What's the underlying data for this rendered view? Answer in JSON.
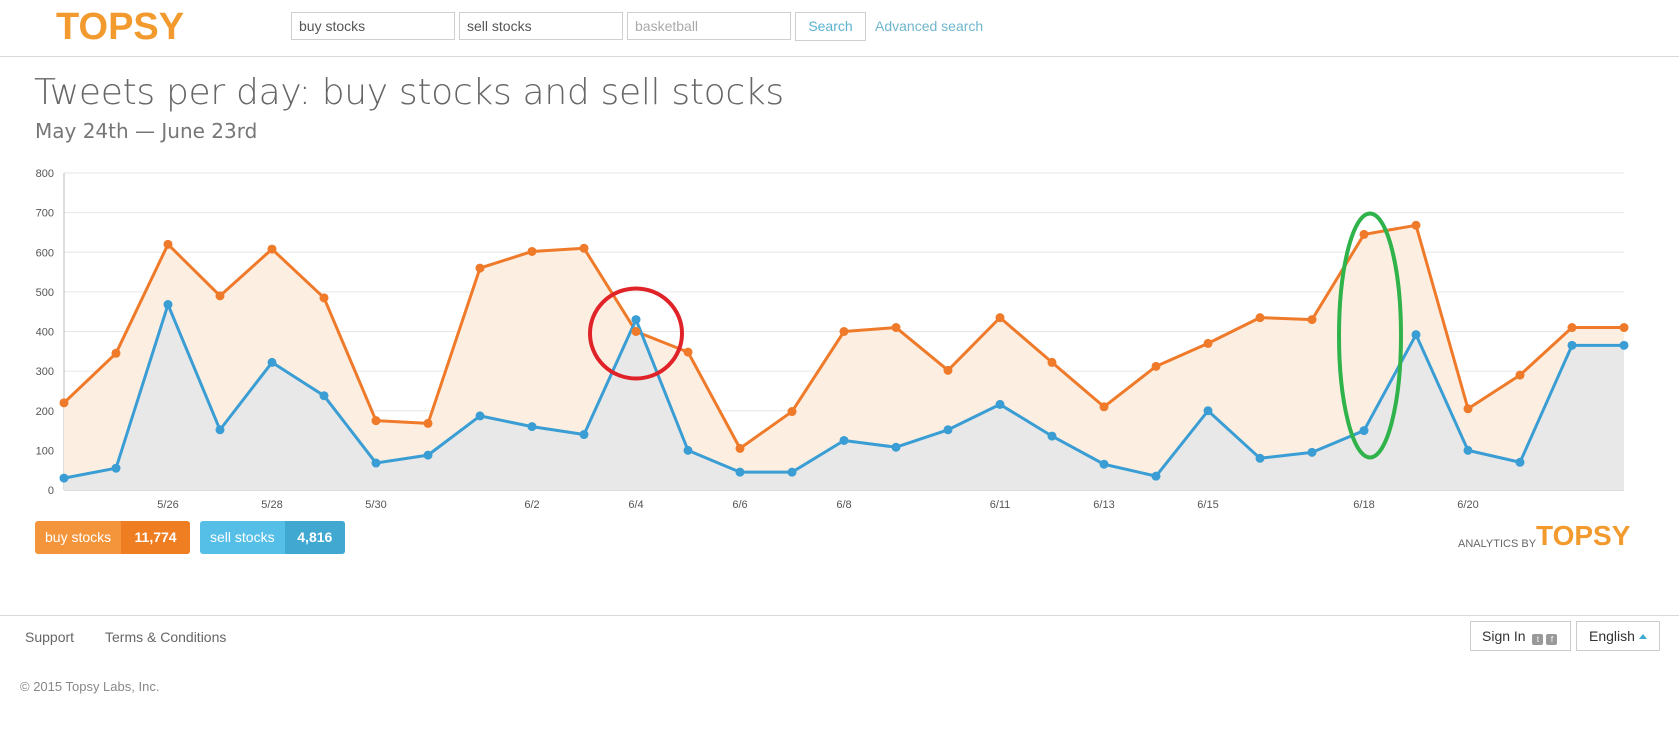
{
  "header": {
    "logo": "TOPSY",
    "queries": [
      {
        "value": "buy stocks",
        "placeholder": ""
      },
      {
        "value": "sell stocks",
        "placeholder": ""
      },
      {
        "value": "",
        "placeholder": "basketball"
      }
    ],
    "search_label": "Search",
    "advanced_label": "Advanced search"
  },
  "page": {
    "title": "Tweets per day: buy stocks and sell stocks",
    "subtitle": "May 24th — June 23rd"
  },
  "chart_data": {
    "type": "area",
    "title": "Tweets per day: buy stocks and sell stocks",
    "ylim": [
      0,
      800
    ],
    "yticks": [
      0,
      100,
      200,
      300,
      400,
      500,
      600,
      700,
      800
    ],
    "x": [
      "5/24",
      "5/25",
      "5/26",
      "5/27",
      "5/28",
      "5/29",
      "5/30",
      "5/31",
      "6/1",
      "6/2",
      "6/3",
      "6/4",
      "6/5",
      "6/6",
      "6/7",
      "6/8",
      "6/9",
      "6/10",
      "6/11",
      "6/12",
      "6/13",
      "6/14",
      "6/15",
      "6/16",
      "6/17",
      "6/18",
      "6/19",
      "6/20",
      "6/21",
      "6/22",
      "6/23"
    ],
    "xtick_labels": [
      "5/26",
      "5/28",
      "5/30",
      "6/2",
      "6/4",
      "6/6",
      "6/8",
      "6/11",
      "6/13",
      "6/15",
      "6/18",
      "6/20"
    ],
    "grid": true,
    "series": [
      {
        "name": "buy stocks",
        "color": "#ef7a2a",
        "values": [
          220,
          345,
          620,
          490,
          608,
          485,
          175,
          168,
          560,
          602,
          610,
          400,
          348,
          105,
          198,
          400,
          410,
          302,
          435,
          322,
          210,
          312,
          370,
          435,
          430,
          645,
          668,
          205,
          290,
          410,
          410
        ]
      },
      {
        "name": "sell stocks",
        "color": "#3a9ed4",
        "values": [
          30,
          55,
          468,
          152,
          322,
          238,
          68,
          88,
          187,
          160,
          140,
          430,
          100,
          45,
          45,
          125,
          108,
          152,
          216,
          136,
          65,
          35,
          200,
          80,
          95,
          150,
          392,
          100,
          70,
          365,
          365
        ]
      }
    ],
    "annotations": [
      {
        "shape": "circle",
        "color": "#e02329",
        "at_x": "6/4"
      },
      {
        "shape": "ellipse",
        "color": "#2fb34a",
        "at_x": "6/18"
      }
    ]
  },
  "legend": {
    "buy_label": "buy stocks",
    "buy_total": "11,774",
    "sell_label": "sell stocks",
    "sell_total": "4,816"
  },
  "branding": {
    "analytics_by": "ANALYTICS BY",
    "logo": "TOPSY"
  },
  "footer": {
    "support": "Support",
    "terms": "Terms & Conditions",
    "sign_in": "Sign In",
    "language": "English",
    "copyright": "© 2015 Topsy Labs, Inc."
  }
}
